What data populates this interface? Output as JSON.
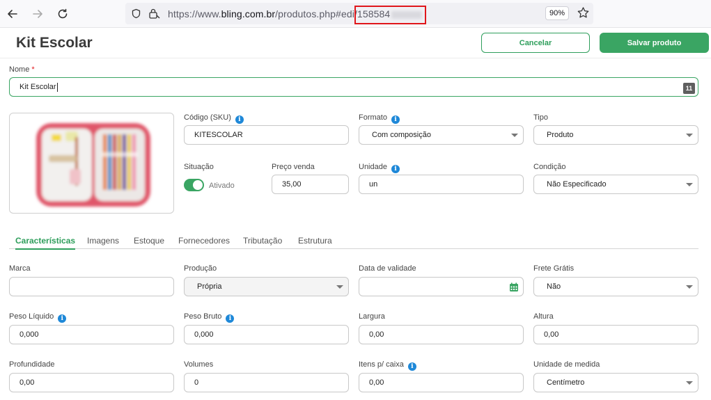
{
  "browser": {
    "url_prefix": "https://www.",
    "url_host": "bling.com.br",
    "url_path": "/produtos.php#edi",
    "url_id": "/158584",
    "zoom": "90%"
  },
  "header": {
    "title": "Kit Escolar",
    "cancel_label": "Cancelar",
    "save_label": "Salvar produto"
  },
  "form": {
    "nome_label": "Nome",
    "nome_required": "*",
    "nome_value": "Kit Escolar",
    "nome_count": "11",
    "codigo_label": "Código (SKU)",
    "codigo_value": "KITESCOLAR",
    "formato_label": "Formato",
    "formato_value": "Com composição",
    "tipo_label": "Tipo",
    "tipo_value": "Produto",
    "situacao_label": "Situação",
    "situacao_value": "Ativado",
    "situacao_on": true,
    "preco_label": "Preço venda",
    "preco_value": "35,00",
    "unidade_label": "Unidade",
    "unidade_value": "un",
    "condicao_label": "Condição",
    "condicao_value": "Não Especificado"
  },
  "tabs": [
    {
      "label": "Características",
      "active": true
    },
    {
      "label": "Imagens",
      "active": false
    },
    {
      "label": "Estoque",
      "active": false
    },
    {
      "label": "Fornecedores",
      "active": false
    },
    {
      "label": "Tributação",
      "active": false
    },
    {
      "label": "Estrutura",
      "active": false
    }
  ],
  "details": {
    "marca_label": "Marca",
    "marca_value": "",
    "producao_label": "Produção",
    "producao_value": "Própria",
    "validade_label": "Data de validade",
    "validade_value": "",
    "frete_label": "Frete Grátis",
    "frete_value": "Não",
    "peso_liquido_label": "Peso Líquido",
    "peso_liquido_value": "0,000",
    "peso_bruto_label": "Peso Bruto",
    "peso_bruto_value": "0,000",
    "largura_label": "Largura",
    "largura_value": "0,00",
    "altura_label": "Altura",
    "altura_value": "0,00",
    "profundidade_label": "Profundidade",
    "profundidade_value": "0,00",
    "volumes_label": "Volumes",
    "volumes_value": "0",
    "itens_caixa_label": "Itens p/ caixa",
    "itens_caixa_value": "0,00",
    "unidade_medida_label": "Unidade de medida",
    "unidade_medida_value": "Centímetro"
  },
  "colors": {
    "accent": "#3aa563",
    "info": "#1e88d8",
    "highlight": "#e0161b"
  }
}
